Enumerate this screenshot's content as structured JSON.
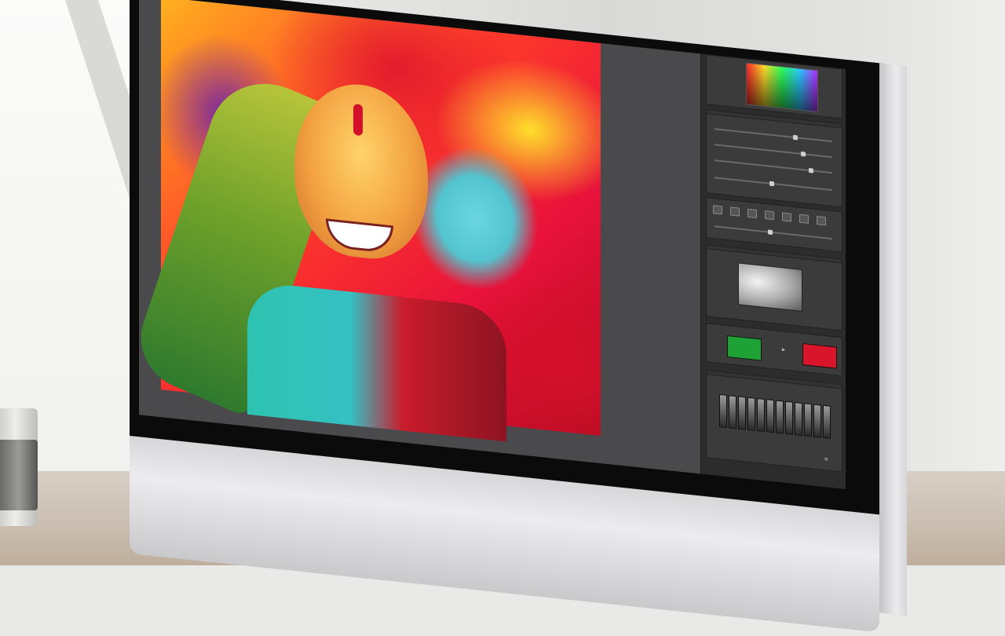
{
  "app": {
    "canvas": {
      "artwork_description_colors": {
        "accent_red": "#e31b2d",
        "accent_yellow": "#ffe02b",
        "accent_cyan": "#53c4cf",
        "accent_green": "#6ea12a"
      }
    },
    "panels": {
      "color": {
        "title": ""
      },
      "adjust": {
        "title": ""
      },
      "tools": {
        "icons": [
          "crop-icon",
          "brush-icon",
          "eraser-icon",
          "stamp-icon",
          "text-icon",
          "shape-icon",
          "hand-icon"
        ]
      },
      "gradient": {
        "title": ""
      },
      "swatches": {
        "colors": [
          "#1ea135",
          "#d8152a"
        ]
      },
      "levels": {
        "title": ""
      }
    },
    "colors": {
      "screen_bg": "#3a3a3b",
      "panel_bg": "#3b3b3c",
      "bezel": "#0b0b0c"
    }
  }
}
